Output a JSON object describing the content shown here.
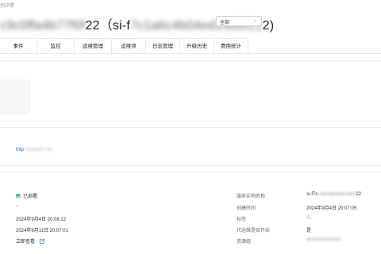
{
  "breadcrumb": "例详情",
  "header": {
    "title_prefix": "c",
    "title_hidden_1": "9c0ffa4b77f0f",
    "title_mid": "22（si-f",
    "title_hidden_2": "7c1a6c4b04ed14d0f21",
    "title_suffix": "2)",
    "select_value": "全部"
  },
  "tabs": [
    "事件",
    "监控",
    "运维管理",
    "运维项",
    "日志管理",
    "升级历史",
    "费用统计"
  ],
  "endpoint": {
    "prefix": "http",
    "hidden": "://xxxxxxx.xxx"
  },
  "left_details": {
    "status": "已部署",
    "description": "-",
    "updated_time": "2024年9月4日 20:08:12",
    "upgraded_time": "2024年9月11日 20:07:01",
    "link_label": "立即查看"
  },
  "right_labels": {
    "instance_name": "服务实例名称",
    "created_time": "创建时间",
    "tags": "标签",
    "proxy_enabled": "代运维是否开启",
    "resource_group": "资源组"
  },
  "right_values": {
    "instance_name_prefix": "si-f7c",
    "instance_name_hidden": "1a6c4b04ed14d0f",
    "instance_name_suffix": "22",
    "created_time": "2024年9月4日 20:07:05",
    "proxy_enabled": "是",
    "resource_group": "rg-xxxxxxxxxxxx"
  }
}
